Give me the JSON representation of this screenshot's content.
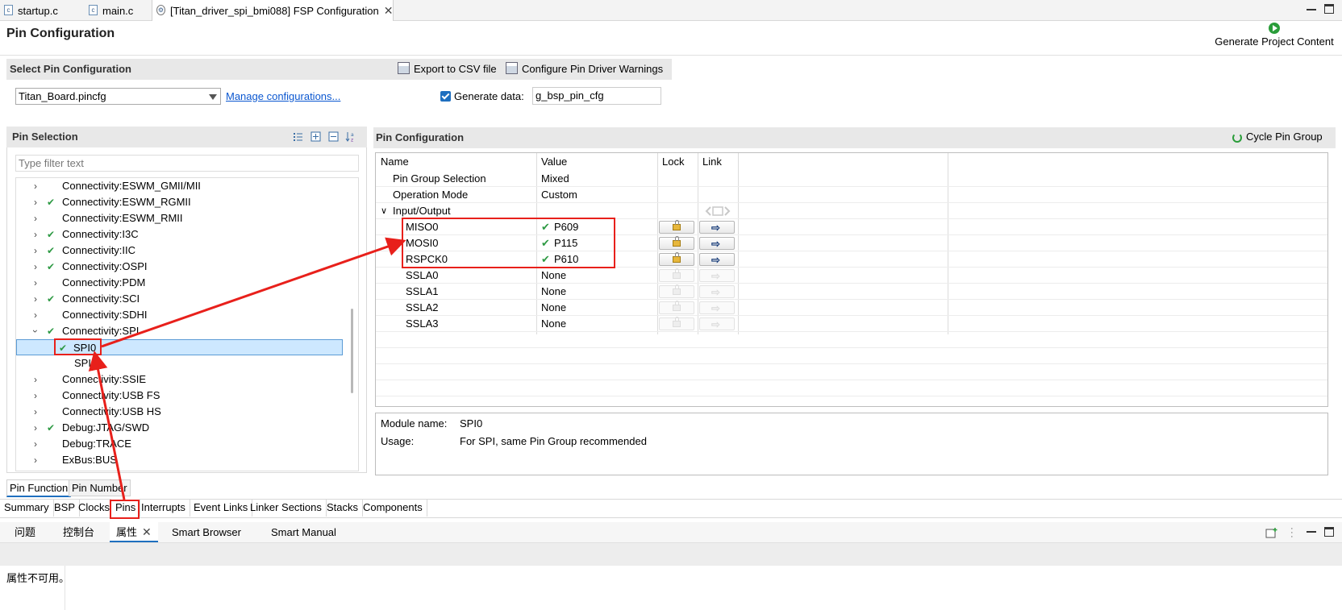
{
  "editor_tabs": [
    {
      "label": "startup.c",
      "icon": "c-file-icon"
    },
    {
      "label": "main.c",
      "icon": "c-file-icon"
    },
    {
      "label": "[Titan_driver_spi_bmi088] FSP Configuration",
      "icon": "gear-icon",
      "active": true
    }
  ],
  "header": {
    "title": "Pin Configuration",
    "generate_label": "Generate Project Content"
  },
  "select_config": {
    "title": "Select Pin Configuration",
    "export_label": "Export to CSV file",
    "warnings_label": "Configure Pin Driver Warnings",
    "selected": "Titan_Board.pincfg",
    "manage_label": "Manage configurations...",
    "generate_data_label": "Generate data:",
    "generate_data_checked": true,
    "generate_data_value": "g_bsp_pin_cfg"
  },
  "pin_selection": {
    "title": "Pin Selection",
    "filter_placeholder": "Type filter text",
    "tree": [
      {
        "label": "Connectivity:ESWM_GMII/MII",
        "expanded": false,
        "checked": false,
        "level": 0
      },
      {
        "label": "Connectivity:ESWM_RGMII",
        "expanded": false,
        "checked": true,
        "level": 0
      },
      {
        "label": "Connectivity:ESWM_RMII",
        "expanded": false,
        "checked": false,
        "level": 0
      },
      {
        "label": "Connectivity:I3C",
        "expanded": false,
        "checked": true,
        "level": 0
      },
      {
        "label": "Connectivity:IIC",
        "expanded": false,
        "checked": true,
        "level": 0
      },
      {
        "label": "Connectivity:OSPI",
        "expanded": false,
        "checked": true,
        "level": 0
      },
      {
        "label": "Connectivity:PDM",
        "expanded": false,
        "checked": false,
        "level": 0
      },
      {
        "label": "Connectivity:SCI",
        "expanded": false,
        "checked": true,
        "level": 0
      },
      {
        "label": "Connectivity:SDHI",
        "expanded": false,
        "checked": false,
        "level": 0
      },
      {
        "label": "Connectivity:SPI",
        "expanded": true,
        "checked": true,
        "level": 0
      },
      {
        "label": "SPI0",
        "checked": true,
        "level": 1,
        "selected": true
      },
      {
        "label": "SPI",
        "checked": false,
        "level": 1
      },
      {
        "label": "Connectivity:SSIE",
        "expanded": false,
        "checked": false,
        "level": 0
      },
      {
        "label": "Connectivity:USB FS",
        "expanded": false,
        "checked": false,
        "level": 0
      },
      {
        "label": "Connectivity:USB HS",
        "expanded": false,
        "checked": false,
        "level": 0
      },
      {
        "label": "Debug:JTAG/SWD",
        "expanded": false,
        "checked": true,
        "level": 0
      },
      {
        "label": "Debug:TRACE",
        "expanded": false,
        "checked": false,
        "level": 0
      },
      {
        "label": "ExBus:BUS",
        "expanded": false,
        "checked": false,
        "level": 0
      }
    ],
    "tabs": [
      "Pin Function",
      "Pin Number"
    ]
  },
  "pin_config": {
    "title": "Pin Configuration",
    "cycle_label": "Cycle Pin Group",
    "columns": [
      "Name",
      "Value",
      "Lock",
      "Link"
    ],
    "rows": [
      {
        "name": "Pin Group Selection",
        "value": "Mixed",
        "level": 1
      },
      {
        "name": "Operation Mode",
        "value": "Custom",
        "level": 1
      },
      {
        "name": "Input/Output",
        "value": "",
        "level": 0,
        "expandable": true
      },
      {
        "name": "MISO0",
        "value": "P609",
        "checked": true,
        "level": 2,
        "enabled": true
      },
      {
        "name": "MOSI0",
        "value": "P115",
        "checked": true,
        "level": 2,
        "enabled": true
      },
      {
        "name": "RSPCK0",
        "value": "P610",
        "checked": true,
        "level": 2,
        "enabled": true
      },
      {
        "name": "SSLA0",
        "value": "None",
        "level": 2,
        "enabled": false
      },
      {
        "name": "SSLA1",
        "value": "None",
        "level": 2,
        "enabled": false
      },
      {
        "name": "SSLA2",
        "value": "None",
        "level": 2,
        "enabled": false
      },
      {
        "name": "SSLA3",
        "value": "None",
        "level": 2,
        "enabled": false
      }
    ],
    "module_name_label": "Module name:",
    "module_name_value": "SPI0",
    "usage_label": "Usage:",
    "usage_value": "For SPI, same Pin Group recommended"
  },
  "editor_bottom_tabs": [
    "Summary",
    "BSP",
    "Clocks",
    "Pins",
    "Interrupts",
    "Event Links",
    "Linker Sections",
    "Stacks",
    "Components"
  ],
  "lower_tabs": [
    {
      "label": "问题"
    },
    {
      "label": "控制台"
    },
    {
      "label": "属性",
      "active": true,
      "closable": true
    },
    {
      "label": "Smart Browser"
    },
    {
      "label": "Smart Manual"
    }
  ],
  "properties_message": "属性不可用。",
  "colors": {
    "accent": "#1f6fbf",
    "check": "#2e9a44",
    "annotation": "#e8201b"
  }
}
